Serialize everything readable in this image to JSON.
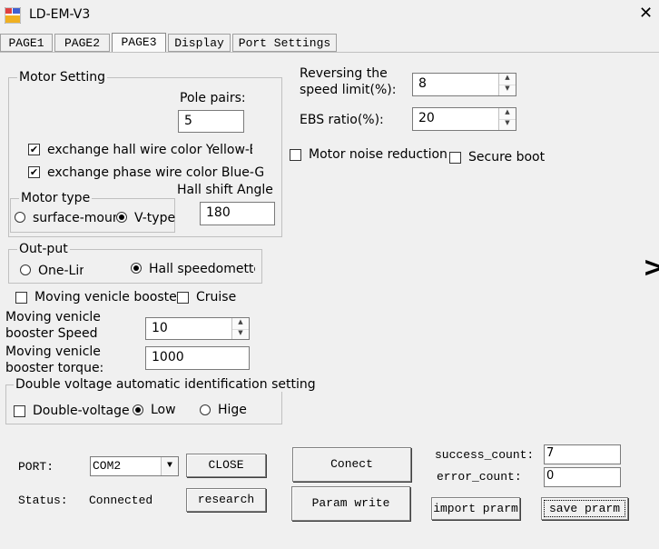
{
  "window": {
    "title": "LD-EM-V3",
    "close_glyph": "✕"
  },
  "tabs": [
    {
      "label": "PAGE1",
      "active": false
    },
    {
      "label": "PAGE2",
      "active": false
    },
    {
      "label": "PAGE3",
      "active": true
    },
    {
      "label": "Display",
      "active": false
    },
    {
      "label": "Port Settings",
      "active": false
    }
  ],
  "motor_setting": {
    "legend": "Motor Setting",
    "pole_pairs_label": "Pole pairs:",
    "pole_pairs_value": "5",
    "hall_wire_label": "exchange hall wire color Yellow-Blue",
    "hall_wire_checked": true,
    "phase_wire_label": "exchange phase wire color Blue-Green",
    "phase_wire_checked": true,
    "motor_type": {
      "legend": "Motor type",
      "surface_label": "surface-mounted",
      "vtype_label": "V-type",
      "selected": "V-type"
    },
    "hall_shift_label": "Hall shift Angle",
    "hall_shift_value": "180"
  },
  "reversing": {
    "label_line1": "Reversing the",
    "label_line2": "speed limit(%):",
    "value": "8"
  },
  "ebs": {
    "label": "EBS ratio(%):",
    "value": "20"
  },
  "noise_reduction": {
    "label": "Motor noise reduction",
    "checked": false
  },
  "secure_boot": {
    "label": "Secure boot",
    "checked": false
  },
  "output": {
    "legend": "Out-put",
    "one_line_label": "One-Line",
    "hall_label": "Hall speedometter",
    "selected": "hall"
  },
  "booster": {
    "label": "Moving venicle booster",
    "checked": false
  },
  "cruise": {
    "label": "Cruise",
    "checked": false
  },
  "booster_speed": {
    "label_line1": "Moving venicle",
    "label_line2": "booster Speed",
    "value": "10"
  },
  "booster_torque": {
    "label_line1": "Moving venicle",
    "label_line2": "booster torque:",
    "value": "1000"
  },
  "double_voltage": {
    "legend": "Double voltage automatic identification setting",
    "checkbox_label": "Double-voltage",
    "checked": false,
    "low_label": "Low",
    "high_label": "Hige",
    "selected": "low"
  },
  "port": {
    "label": "PORT:",
    "value": "COM2",
    "close_button": "CLOSE"
  },
  "status": {
    "label": "Status:",
    "value": "Connected",
    "research_button": "research"
  },
  "connect_button": "Conect",
  "param_write_button": "Param write",
  "counts": {
    "success_label": "success_count:",
    "success_value": "7",
    "error_label": "error_count:",
    "error_value": "0"
  },
  "import_button": "import prarm",
  "save_button": "save prarm",
  "colors": {
    "background": "#f0f0f0",
    "border": "#c0c0c0",
    "input_bg": "#ffffff"
  }
}
